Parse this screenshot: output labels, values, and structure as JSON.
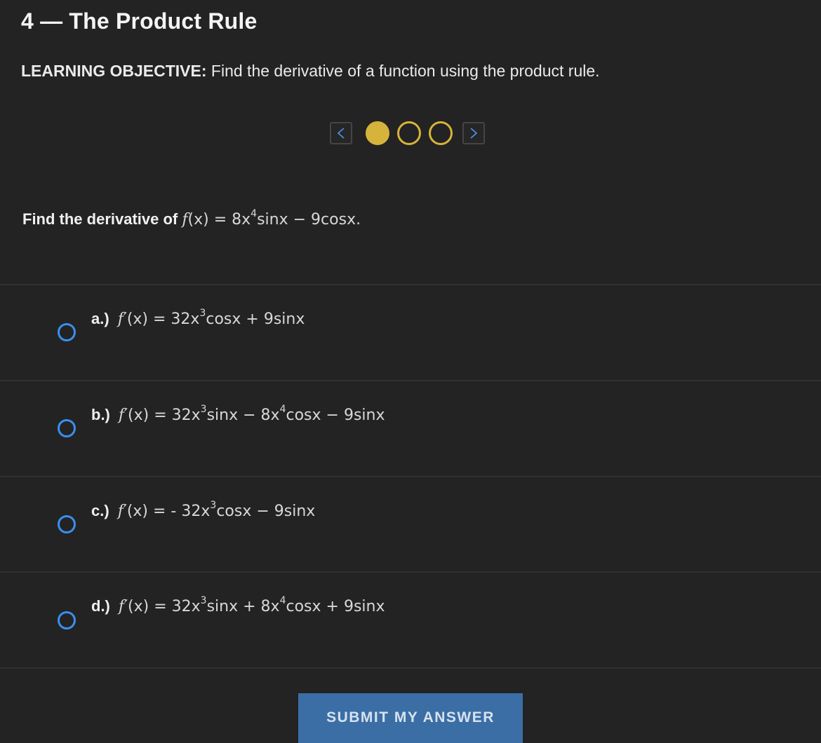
{
  "header": {
    "title": "4 — The Product Rule"
  },
  "objective": {
    "label": "LEARNING OBJECTIVE:",
    "text": "Find the derivative of a function using the product rule."
  },
  "pager": {
    "prev_icon": "chevron-left-icon",
    "next_icon": "chevron-right-icon",
    "current_page": 1,
    "total_pages": 3
  },
  "question": {
    "prompt": "Find the derivative of",
    "fn": "f",
    "expr_a": "(x) = 8x",
    "exp": "4",
    "expr_b": "sinx − 9cosx",
    "end": "."
  },
  "options": [
    {
      "letter": "a.)",
      "fn": "f′",
      "p1": "(x) = 32x",
      "e1": "3",
      "p2": "cosx + 9sinx",
      "e2": "",
      "p3": ""
    },
    {
      "letter": "b.)",
      "fn": "f′",
      "p1": "(x) = 32x",
      "e1": "3",
      "p2": "sinx − 8x",
      "e2": "4",
      "p3": "cosx − 9sinx"
    },
    {
      "letter": "c.)",
      "fn": "f′",
      "p1": "(x) =  - 32x",
      "e1": "3",
      "p2": "cosx − 9sinx",
      "e2": "",
      "p3": ""
    },
    {
      "letter": "d.)",
      "fn": "f′",
      "p1": "(x) = 32x",
      "e1": "3",
      "p2": "sinx + 8x",
      "e2": "4",
      "p3": "cosx + 9sinx"
    }
  ],
  "submit": {
    "label": "SUBMIT MY ANSWER"
  },
  "colors": {
    "background": "#232323",
    "accent_gold": "#d6b43b",
    "radio_blue": "#3a8ff0",
    "submit_blue": "#3a6ea5"
  }
}
